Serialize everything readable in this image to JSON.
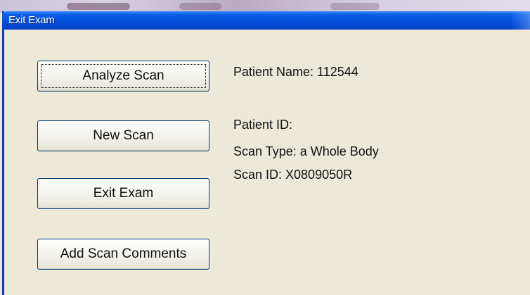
{
  "window": {
    "title": "Exit Exam"
  },
  "buttons": {
    "analyze_scan": "Analyze Scan",
    "new_scan": "New Scan",
    "exit_exam": "Exit Exam",
    "add_scan_comments": "Add Scan Comments"
  },
  "info": {
    "patient_name": "Patient Name:  112544",
    "patient_id": "Patient ID:",
    "scan_type": "Scan Type: a Whole Body",
    "scan_id": "Scan ID: X0809050R"
  },
  "colors": {
    "titlebar": "#0553dc",
    "window_bg": "#ece9d8",
    "button_border": "#003c74"
  }
}
